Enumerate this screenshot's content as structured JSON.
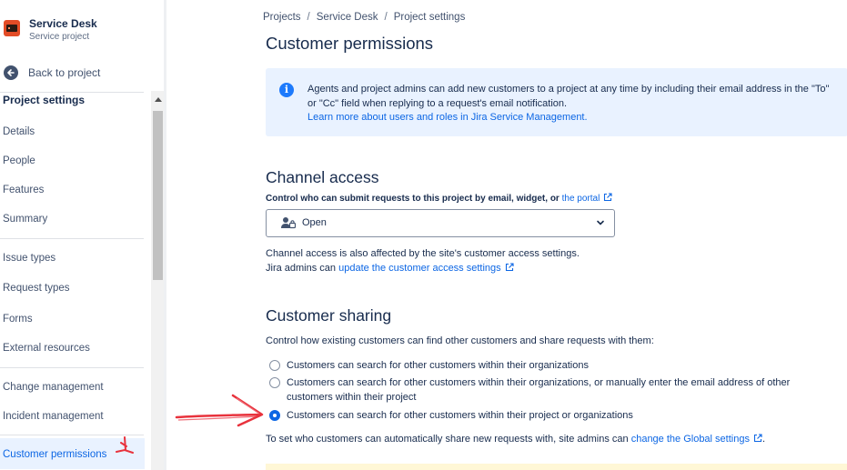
{
  "sidebar": {
    "project_name": "Service Desk",
    "project_type": "Service project",
    "back_label": "Back to project",
    "section_heading": "Project settings",
    "items": [
      {
        "label": "Details"
      },
      {
        "label": "People"
      },
      {
        "label": "Features"
      },
      {
        "label": "Summary"
      },
      {
        "label": "Issue types"
      },
      {
        "label": "Request types"
      },
      {
        "label": "Forms"
      },
      {
        "label": "External resources"
      },
      {
        "label": "Change management"
      },
      {
        "label": "Incident management"
      }
    ],
    "active_item": "Customer permissions"
  },
  "breadcrumbs": [
    "Projects",
    "Service Desk",
    "Project settings"
  ],
  "breadcrumb_separator": "/",
  "page_title": "Customer permissions",
  "info_banner": {
    "text": "Agents and project admins can add new customers to a project at any time by including their email address in the \"To\" or \"Cc\" field when replying to a request's email notification.",
    "link": "Learn more about users and roles in Jira Service Management.",
    "icon": "info-icon",
    "icon_glyph": "i"
  },
  "channel_access": {
    "heading": "Channel access",
    "label": "Control who can submit requests to this project by email, widget, or",
    "label_link": "the portal",
    "selected": "Open",
    "note_line1": "Channel access is also affected by the site's customer access settings.",
    "note_line2_prefix": "Jira admins can",
    "note_line2_link": "update the customer access settings"
  },
  "customer_sharing": {
    "heading": "Customer sharing",
    "description": "Control how existing customers can find other customers and share requests with them:",
    "options": [
      {
        "label": "Customers can search for other customers within their organizations",
        "selected": false
      },
      {
        "label": "Customers can search for other customers within their organizations, or manually enter the email address of other customers within their project",
        "selected": false
      },
      {
        "label": "Customers can search for other customers within their project or organizations",
        "selected": true
      }
    ],
    "footer_prefix": "To set who customers can automatically share new requests with, site admins can",
    "footer_link": "change the Global settings",
    "footer_suffix": "."
  },
  "colors": {
    "accent": "#0c66e4",
    "info_bg": "#e9f2ff",
    "project_icon": "#e34c26",
    "annotation": "#e8323c"
  }
}
